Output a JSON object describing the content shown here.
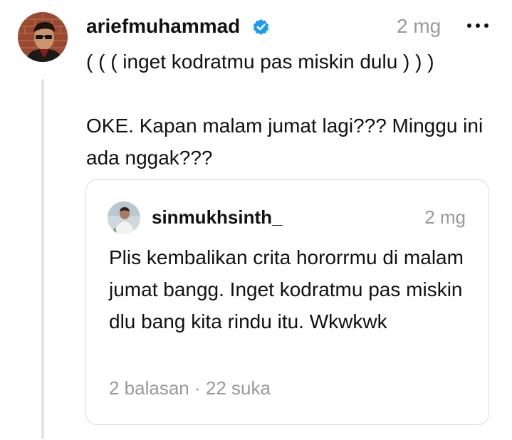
{
  "post": {
    "username": "ariefmuhammad",
    "verified": true,
    "time": "2 mg",
    "text_line1": "( ( ( inget kodratmu pas miskin dulu ) ) )",
    "text_line2": "OKE. Kapan malam jumat lagi??? Minggu ini ada nggak???",
    "more_icon": "more-horizontal-icon"
  },
  "quote": {
    "username": "sinmukhsinth_",
    "time": "2 mg",
    "text": "Plis kembalikan crita hororrmu di malam jumat bangg. Inget kodratmu pas miskin dlu bang kita rindu itu. Wkwkwk",
    "stats": "2 balasan · 22 suka"
  },
  "colors": {
    "verified_badge": "#1d9bf0",
    "muted_text": "#999999",
    "thread_line": "#e3e3e3",
    "card_border": "#dcdcdc"
  }
}
